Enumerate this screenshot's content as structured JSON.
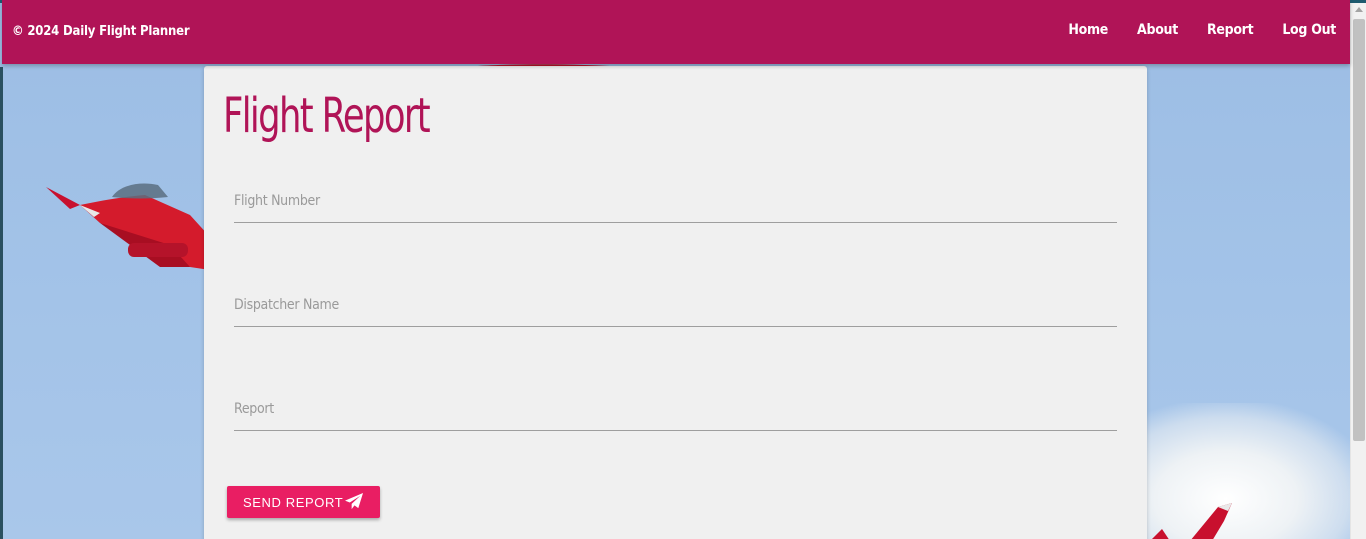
{
  "navbar": {
    "brand": "© 2024 Daily Flight Planner",
    "links": [
      {
        "label": "Home"
      },
      {
        "label": "About"
      },
      {
        "label": "Report"
      },
      {
        "label": "Log Out"
      }
    ],
    "color": "#b01457"
  },
  "form": {
    "title": "Flight Report",
    "fields": [
      {
        "label": "Flight Number",
        "value": ""
      },
      {
        "label": "Dispatcher Name",
        "value": ""
      },
      {
        "label": "Report",
        "value": ""
      }
    ],
    "submit_label": "Send Report",
    "submit_icon": "paper-plane-icon",
    "button_color": "#e91e63"
  }
}
